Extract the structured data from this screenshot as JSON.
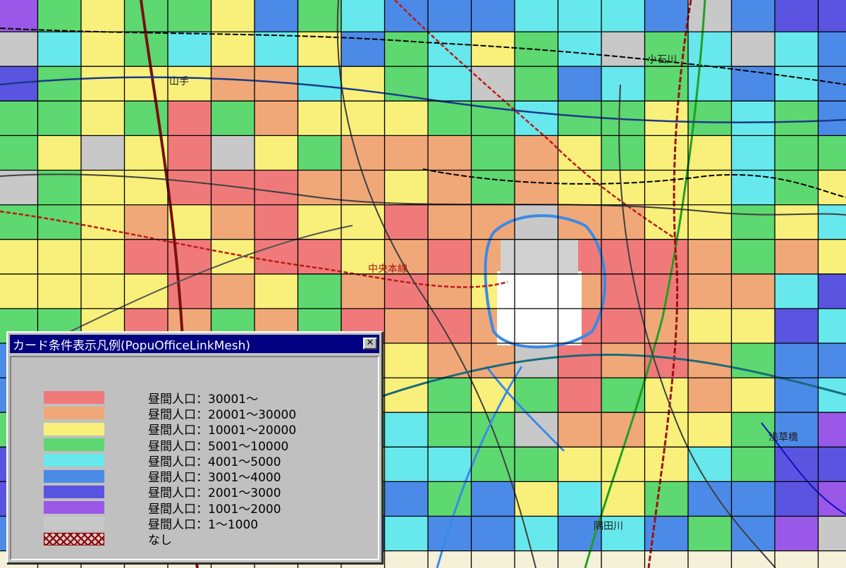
{
  "map": {
    "place_labels": [
      "山手",
      "中央本線",
      "小石川",
      "浅草橋",
      "隅田川"
    ]
  },
  "legend": {
    "title": "カード条件表示凡例(PopuOfficeLinkMesh)",
    "close_label": "✕",
    "items": [
      {
        "label": "昼間人口：30001〜",
        "color": "#f07a7a"
      },
      {
        "label": "昼間人口：20001〜30000",
        "color": "#f0a878"
      },
      {
        "label": "昼間人口：10001〜20000",
        "color": "#f8f07a"
      },
      {
        "label": "昼間人口：5001〜10000",
        "color": "#5ed870"
      },
      {
        "label": "昼間人口：4001〜5000",
        "color": "#66e8ec"
      },
      {
        "label": "昼間人口：3001〜4000",
        "color": "#4c8ae8"
      },
      {
        "label": "昼間人口：2001〜3000",
        "color": "#5a54e0"
      },
      {
        "label": "昼間人口：1001〜2000",
        "color": "#9a58e8"
      },
      {
        "label": "昼間人口：1〜1000",
        "color": "#c8c8c8"
      },
      {
        "label": "なし",
        "color": "#8b0000"
      }
    ]
  }
}
